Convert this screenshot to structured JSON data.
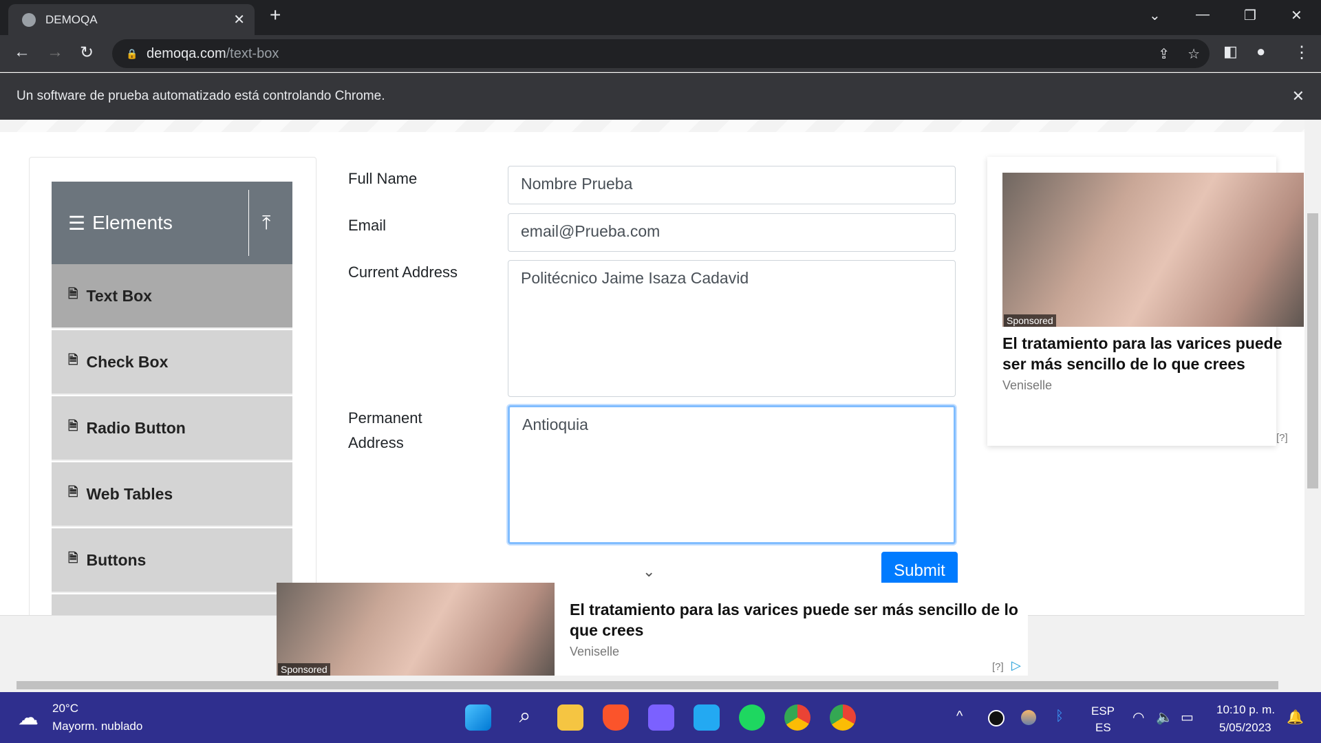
{
  "browser": {
    "tab_title": "DEMOQA",
    "url_domain": "demoqa.com",
    "url_path": "/text-box",
    "automation_notice": "Un software de prueba automatizado está controlando Chrome."
  },
  "sidebar": {
    "header": "Elements",
    "items": [
      {
        "label": "Text Box"
      },
      {
        "label": "Check Box"
      },
      {
        "label": "Radio Button"
      },
      {
        "label": "Web Tables"
      },
      {
        "label": "Buttons"
      }
    ]
  },
  "form": {
    "full_name_label": "Full Name",
    "full_name_value": "Nombre Prueba",
    "email_label": "Email",
    "email_value": "email@Prueba.com",
    "current_address_label": "Current Address",
    "current_address_value": "Politécnico Jaime Isaza Cadavid",
    "permanent_address_label": "Permanent Address",
    "permanent_address_value": "Antioquia",
    "submit_label": "Submit"
  },
  "ad_side": {
    "badge": "Sponsored",
    "title": "El tratamiento para las varices puede ser más sencillo de lo que crees",
    "source": "Veniselle",
    "info": "[?]"
  },
  "ad_bottom": {
    "badge": "Sponsored",
    "title": "El tratamiento para las varices puede ser más sencillo de lo que crees",
    "source": "Veniselle",
    "info": "[?]"
  },
  "taskbar": {
    "temperature": "20°C",
    "weather": "Mayorm. nublado",
    "lang1": "ESP",
    "lang2": "ES",
    "time": "10:10 p. m.",
    "date": "5/05/2023"
  }
}
